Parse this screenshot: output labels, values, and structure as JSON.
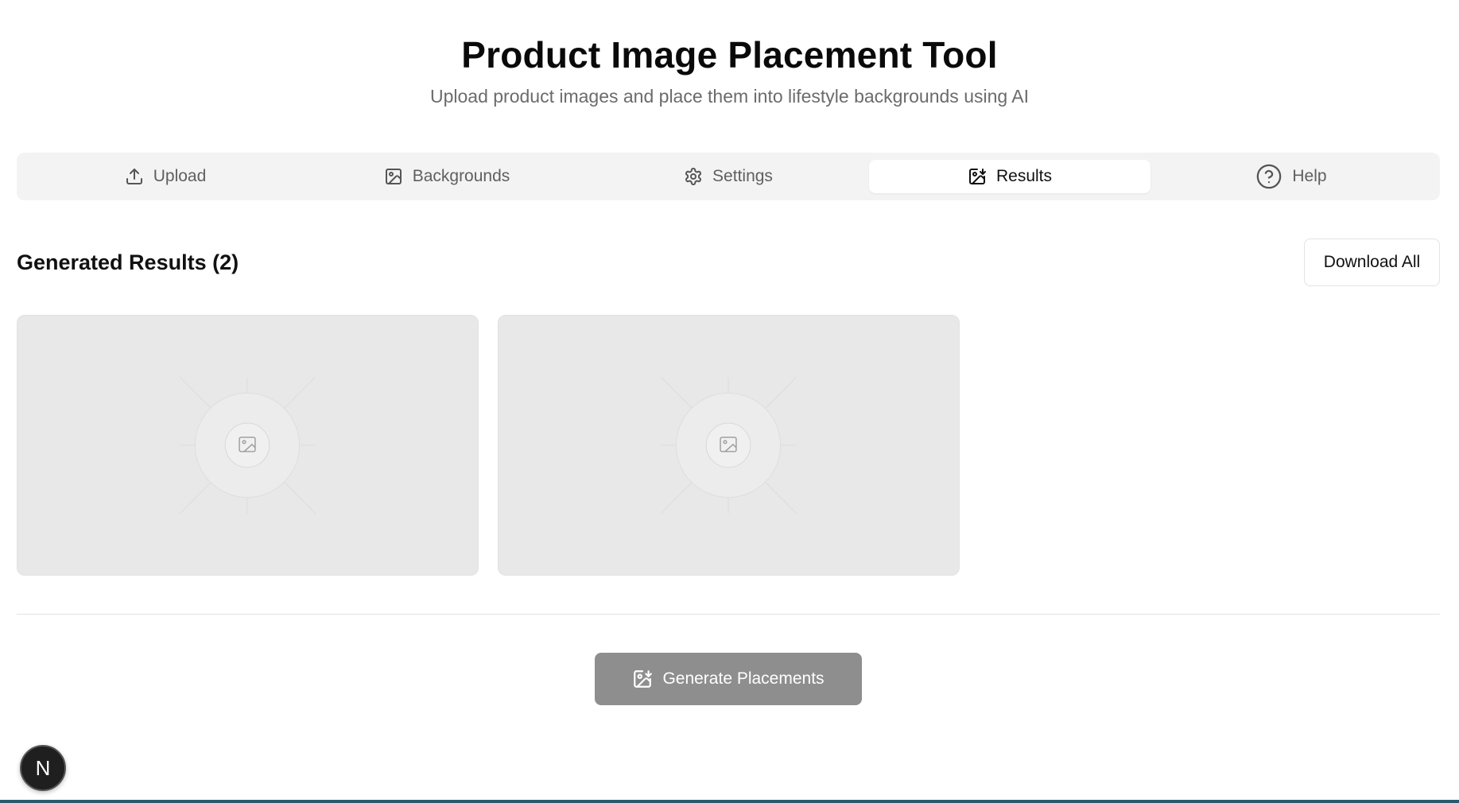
{
  "header": {
    "title": "Product Image Placement Tool",
    "subtitle": "Upload product images and place them into lifestyle backgrounds using AI"
  },
  "tabs": [
    {
      "label": "Upload",
      "icon": "upload-icon",
      "active": false
    },
    {
      "label": "Backgrounds",
      "icon": "image-icon",
      "active": false
    },
    {
      "label": "Settings",
      "icon": "gear-icon",
      "active": false
    },
    {
      "label": "Results",
      "icon": "image-download-icon",
      "active": true
    },
    {
      "label": "Help",
      "icon": "help-circle-icon",
      "active": false
    }
  ],
  "results": {
    "title": "Generated Results (2)",
    "download_all_label": "Download All",
    "items": [
      {
        "icon": "image-placeholder-icon"
      },
      {
        "icon": "image-placeholder-icon"
      }
    ]
  },
  "actions": {
    "generate_label": "Generate Placements"
  },
  "badge": {
    "letter": "N"
  },
  "colors": {
    "accent_disabled": "#8e8e8e",
    "tab_bar_bg": "#f3f3f3",
    "card_bg": "#e8e8e8"
  }
}
